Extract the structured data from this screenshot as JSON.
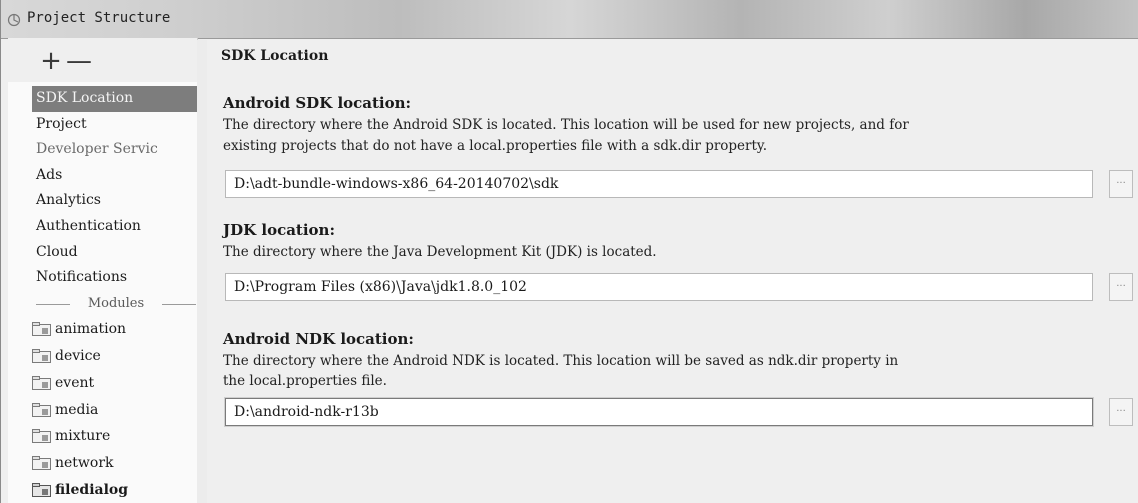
{
  "window": {
    "title": "Project Structure",
    "icon": "project-structure-icon"
  },
  "sidebar": {
    "add_symbol": "+",
    "remove_symbol": "—",
    "items": [
      {
        "label": "SDK Location",
        "selected": true
      },
      {
        "label": "Project"
      },
      {
        "label": "Developer Servic",
        "group": true
      },
      {
        "label": "Ads"
      },
      {
        "label": "Analytics"
      },
      {
        "label": "Authentication"
      },
      {
        "label": "Cloud"
      },
      {
        "label": "Notifications"
      }
    ],
    "modules_label": "Modules",
    "modules": [
      {
        "label": "animation",
        "icon": "module-folder-icon"
      },
      {
        "label": "device",
        "icon": "module-folder-icon"
      },
      {
        "label": "event",
        "icon": "module-folder-icon"
      },
      {
        "label": "media",
        "icon": "module-folder-icon"
      },
      {
        "label": "mixture",
        "icon": "module-folder-icon"
      },
      {
        "label": "network",
        "icon": "module-folder-icon"
      },
      {
        "label": "filedialog",
        "icon": "module-folder-icon"
      }
    ]
  },
  "main": {
    "page_title": "SDK Location",
    "android_sdk": {
      "title": "Android SDK location:",
      "description_line1": "The directory where the Android SDK is located. This location will be used for new projects, and for",
      "description_line2": "existing projects that do not have a local.properties file with a sdk.dir property.",
      "value": "D:\\adt-bundle-windows-x86_64-20140702\\sdk",
      "browse_label": "..."
    },
    "jdk": {
      "title": "JDK location:",
      "description_line1": "The directory where the Java Development Kit (JDK) is located.",
      "value": "D:\\Program Files (x86)\\Java\\jdk1.8.0_102",
      "browse_label": "..."
    },
    "android_ndk": {
      "title": "Android NDK location:",
      "description_line1": "The directory where the Android NDK is located. This location will be saved as ndk.dir property in",
      "description_line2": "the local.properties file.",
      "value": "D:\\android-ndk-r13b",
      "browse_label": "..."
    }
  },
  "colors": {
    "selected_bg": "#7d7d7d",
    "panel_bg": "#efefef"
  }
}
